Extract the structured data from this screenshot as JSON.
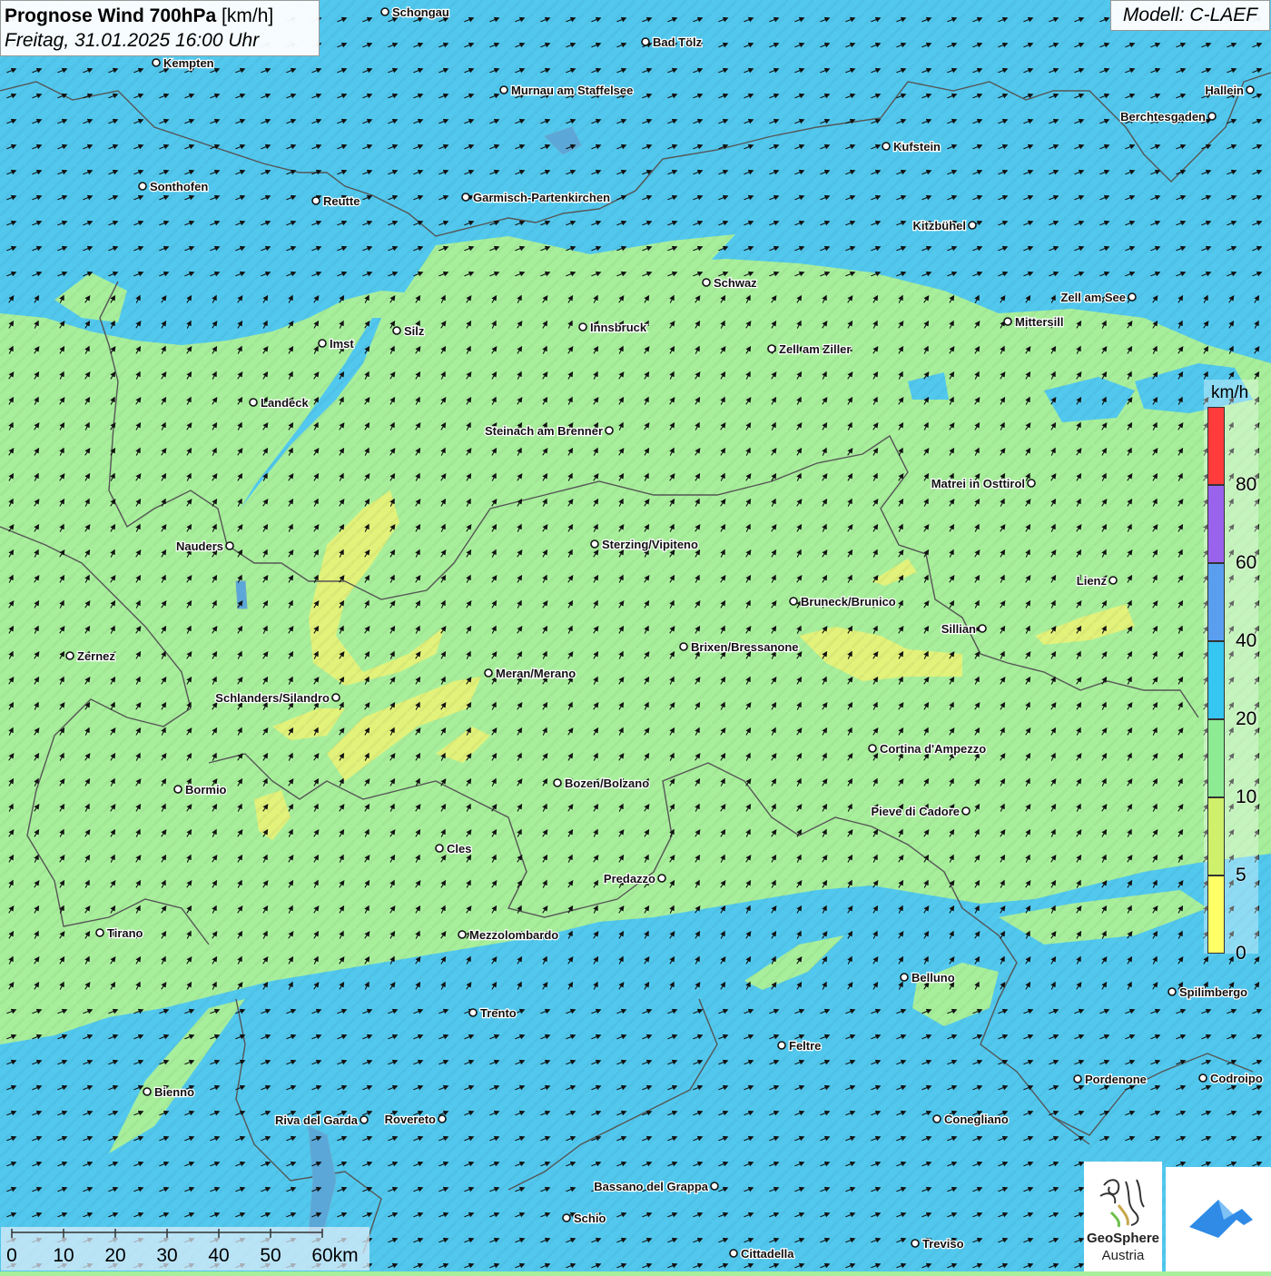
{
  "title": {
    "main": "Prognose Wind 700hPa",
    "unit": "[km/h]",
    "datetime": "Freitag, 31.01.2025 16:00 Uhr"
  },
  "model": "Modell: C-LAEF",
  "legend": {
    "unit": "km/h",
    "items": [
      {
        "value": "80",
        "color": "#ff3b3b"
      },
      {
        "value": "60",
        "color": "#9a63ee"
      },
      {
        "value": "40",
        "color": "#5a9ef0"
      },
      {
        "value": "20",
        "color": "#35c6f2"
      },
      {
        "value": "10",
        "color": "#8deb93"
      },
      {
        "value": "5",
        "color": "#cff06a"
      },
      {
        "value": "0",
        "color": "#ffff66"
      }
    ]
  },
  "scale": {
    "labels": [
      "0",
      "10",
      "20",
      "30",
      "40",
      "50",
      "60km"
    ]
  },
  "colors": {
    "band_blue": "#52c8ee",
    "band_green": "#a8ef9c",
    "band_yellow": "#e2f27a",
    "border_line": "#555555",
    "arrow": "#111111"
  },
  "cities": [
    {
      "name": "Schongau",
      "label_side": "right"
    },
    {
      "name": "Bad Tölz",
      "label_side": "right"
    },
    {
      "name": "Kempten",
      "label_side": "right"
    },
    {
      "name": "Murnau am Staffelsee",
      "label_side": "right"
    },
    {
      "name": "Hallein",
      "label_side": "left"
    },
    {
      "name": "Berchtesgaden",
      "label_side": "left"
    },
    {
      "name": "Kufstein",
      "label_side": "right"
    },
    {
      "name": "Sonthofen",
      "label_side": "right"
    },
    {
      "name": "Reutte",
      "label_side": "right"
    },
    {
      "name": "Garmisch-Partenkirchen",
      "label_side": "right"
    },
    {
      "name": "Kitzbühel",
      "label_side": "left"
    },
    {
      "name": "Schwaz",
      "label_side": "right"
    },
    {
      "name": "Zell am See",
      "label_side": "left"
    },
    {
      "name": "Innsbruck",
      "label_side": "right"
    },
    {
      "name": "Mittersill",
      "label_side": "right"
    },
    {
      "name": "Imst",
      "label_side": "right"
    },
    {
      "name": "Silz",
      "label_side": "right"
    },
    {
      "name": "Zell am Ziller",
      "label_side": "right"
    },
    {
      "name": "Landeck",
      "label_side": "right"
    },
    {
      "name": "Steinach am Brenner",
      "label_side": "left"
    },
    {
      "name": "Matrei in Osttirol",
      "label_side": "left"
    },
    {
      "name": "Nauders",
      "label_side": "left"
    },
    {
      "name": "Sterzing/Vipiteno",
      "label_side": "right"
    },
    {
      "name": "Lienz",
      "label_side": "left"
    },
    {
      "name": "Bruneck/Brunico",
      "label_side": "right"
    },
    {
      "name": "Sillian",
      "label_side": "left"
    },
    {
      "name": "Zernez",
      "label_side": "right"
    },
    {
      "name": "Brixen/Bressanone",
      "label_side": "right"
    },
    {
      "name": "Meran/Merano",
      "label_side": "right"
    },
    {
      "name": "Schlanders/Silandro",
      "label_side": "left"
    },
    {
      "name": "Cortina d'Ampezzo",
      "label_side": "right"
    },
    {
      "name": "Bozen/Bolzano",
      "label_side": "right"
    },
    {
      "name": "Bormio",
      "label_side": "right"
    },
    {
      "name": "Pieve di Cadore",
      "label_side": "left"
    },
    {
      "name": "Cles",
      "label_side": "right"
    },
    {
      "name": "Predazzo",
      "label_side": "left"
    },
    {
      "name": "Tirano",
      "label_side": "right"
    },
    {
      "name": "Mezzolombardo",
      "label_side": "right"
    },
    {
      "name": "Belluno",
      "label_side": "right"
    },
    {
      "name": "Spilimbergo",
      "label_side": "right"
    },
    {
      "name": "Trento",
      "label_side": "right"
    },
    {
      "name": "Feltre",
      "label_side": "right"
    },
    {
      "name": "Pordenone",
      "label_side": "right"
    },
    {
      "name": "Codroipo",
      "label_side": "right"
    },
    {
      "name": "Bienno",
      "label_side": "right"
    },
    {
      "name": "Riva del Garda",
      "label_side": "left"
    },
    {
      "name": "Rovereto",
      "label_side": "left"
    },
    {
      "name": "Conegliano",
      "label_side": "right"
    },
    {
      "name": "Bassano del Grappa",
      "label_side": "left"
    },
    {
      "name": "Schio",
      "label_side": "right"
    },
    {
      "name": "Treviso",
      "label_side": "right"
    },
    {
      "name": "Cittadella",
      "label_side": "right"
    }
  ],
  "logos": {
    "geosphere_line1": "GeoSphere",
    "geosphere_line2": "Austria"
  }
}
